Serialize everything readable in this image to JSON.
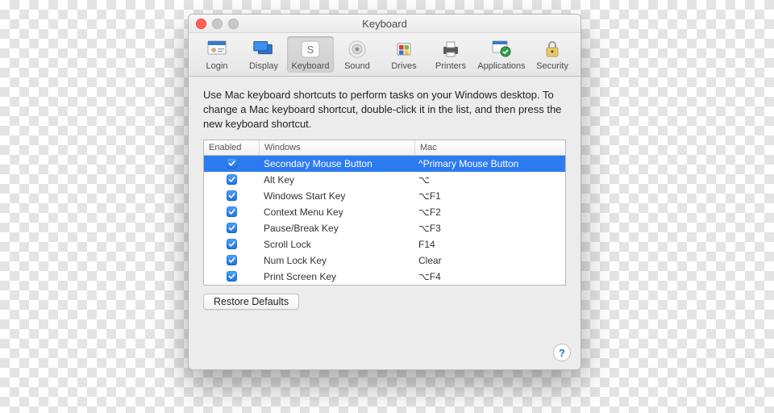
{
  "window": {
    "title": "Keyboard"
  },
  "toolbar": {
    "items": [
      {
        "id": "login",
        "label": "Login",
        "icon": "login-icon"
      },
      {
        "id": "display",
        "label": "Display",
        "icon": "display-icon"
      },
      {
        "id": "keyboard",
        "label": "Keyboard",
        "icon": "keyboard-icon",
        "selected": true
      },
      {
        "id": "sound",
        "label": "Sound",
        "icon": "sound-icon"
      },
      {
        "id": "drives",
        "label": "Drives",
        "icon": "drives-icon"
      },
      {
        "id": "printers",
        "label": "Printers",
        "icon": "printers-icon"
      },
      {
        "id": "applications",
        "label": "Applications",
        "icon": "applications-icon"
      },
      {
        "id": "security",
        "label": "Security",
        "icon": "security-icon"
      }
    ]
  },
  "intro": "Use Mac keyboard shortcuts to perform tasks on your Windows desktop. To change a Mac keyboard shortcut, double-click it in the list, and then press the new keyboard shortcut.",
  "table": {
    "columns": {
      "enabled": "Enabled",
      "windows": "Windows",
      "mac": "Mac"
    },
    "rows": [
      {
        "enabled": true,
        "windows": "Secondary Mouse Button",
        "mac": "^Primary Mouse Button",
        "selected": true
      },
      {
        "enabled": true,
        "windows": "Alt Key",
        "mac": "⌥"
      },
      {
        "enabled": true,
        "windows": "Windows Start Key",
        "mac": "⌥F1"
      },
      {
        "enabled": true,
        "windows": "Context Menu Key",
        "mac": "⌥F2"
      },
      {
        "enabled": true,
        "windows": "Pause/Break Key",
        "mac": "⌥F3"
      },
      {
        "enabled": true,
        "windows": "Scroll Lock",
        "mac": "F14"
      },
      {
        "enabled": true,
        "windows": "Num Lock Key",
        "mac": "Clear"
      },
      {
        "enabled": true,
        "windows": "Print Screen Key",
        "mac": "⌥F4"
      }
    ]
  },
  "buttons": {
    "restore_defaults": "Restore Defaults"
  },
  "help": "?"
}
